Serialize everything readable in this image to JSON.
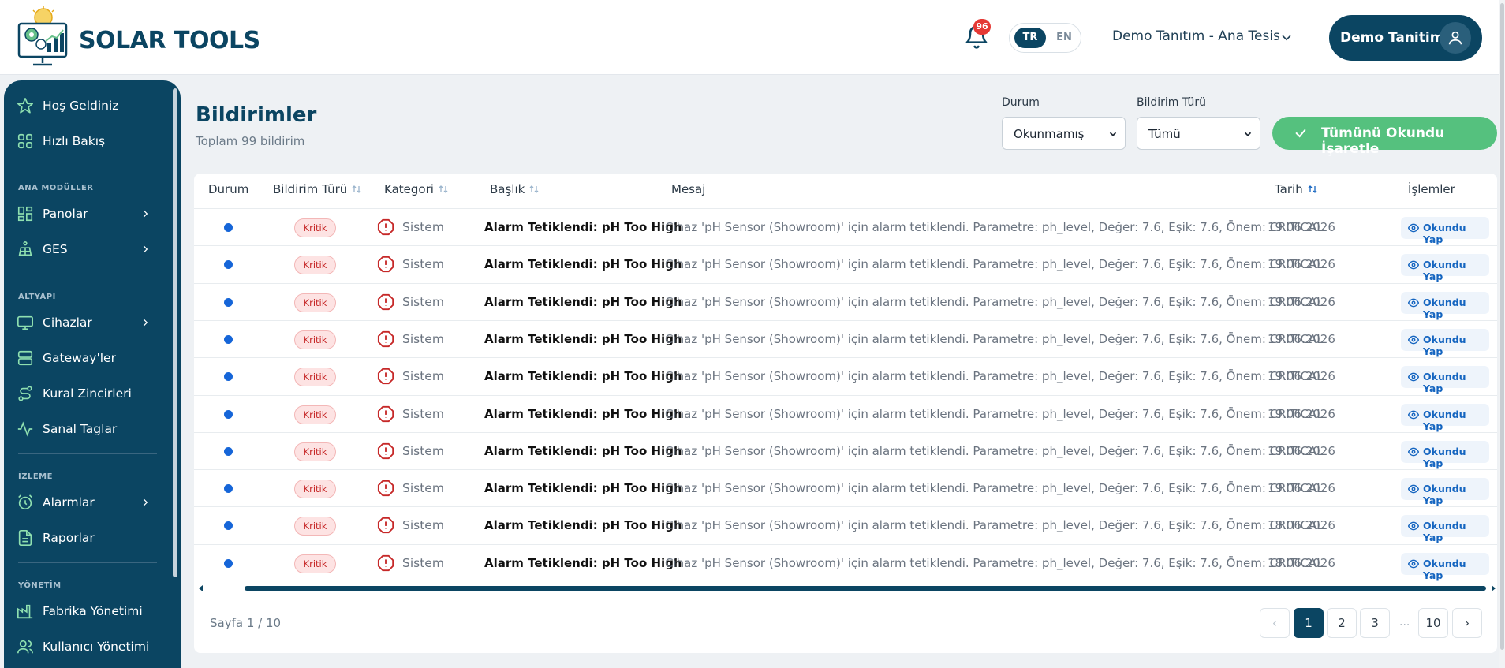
{
  "header": {
    "brand": "SOLAR TOOLS",
    "notification_count": "96",
    "lang_tr": "TR",
    "lang_en": "EN",
    "facility": "Demo Tanıtım - Ana Tesis",
    "user_name": "Demo Tanitim"
  },
  "sidebar": {
    "welcome": "Hoş Geldiniz",
    "overview": "Hızlı Bakış",
    "section_main": "ANA MODÜLLER",
    "dashboards": "Panolar",
    "ges": "GES",
    "section_infra": "ALTYAPI",
    "devices": "Cihazlar",
    "gateways": "Gateway'ler",
    "rule_chains": "Kural Zincirleri",
    "virtual_tags": "Sanal Taglar",
    "section_monitor": "İZLEME",
    "alarms": "Alarmlar",
    "reports": "Raporlar",
    "section_admin": "YÖNETİM",
    "factory_mgmt": "Fabrika Yönetimi",
    "user_mgmt": "Kullanıcı Yönetimi"
  },
  "page": {
    "title": "Bildirimler",
    "subtitle": "Toplam 99 bildirim"
  },
  "filters": {
    "status_label": "Durum",
    "status_value": "Okunmamış",
    "type_label": "Bildirim Türü",
    "type_value": "Tümü",
    "mark_all": "Tümünü Okundu İşaretle"
  },
  "table": {
    "headers": {
      "status": "Durum",
      "type": "Bildirim Türü",
      "category": "Kategori",
      "title": "Başlık",
      "message": "Mesaj",
      "date": "Tarih",
      "actions": "İşlemler"
    },
    "rows": [
      {
        "type": "Kritik",
        "category": "Sistem",
        "title": "Alarm Tetiklendi: pH Too High",
        "message": "Cihaz 'pH Sensor (Showroom)' için alarm tetiklendi. Parametre: ph_level, Değer: 7.6, Eşik: 7.6, Önem: CRITICAL",
        "date": "19.06.2026",
        "action": "Okundu Yap"
      },
      {
        "type": "Kritik",
        "category": "Sistem",
        "title": "Alarm Tetiklendi: pH Too High",
        "message": "Cihaz 'pH Sensor (Showroom)' için alarm tetiklendi. Parametre: ph_level, Değer: 7.6, Eşik: 7.6, Önem: CRITICAL",
        "date": "19.06.2026",
        "action": "Okundu Yap"
      },
      {
        "type": "Kritik",
        "category": "Sistem",
        "title": "Alarm Tetiklendi: pH Too High",
        "message": "Cihaz 'pH Sensor (Showroom)' için alarm tetiklendi. Parametre: ph_level, Değer: 7.6, Eşik: 7.6, Önem: CRITICAL",
        "date": "19.06.2026",
        "action": "Okundu Yap"
      },
      {
        "type": "Kritik",
        "category": "Sistem",
        "title": "Alarm Tetiklendi: pH Too High",
        "message": "Cihaz 'pH Sensor (Showroom)' için alarm tetiklendi. Parametre: ph_level, Değer: 7.6, Eşik: 7.6, Önem: CRITICAL",
        "date": "19.06.2026",
        "action": "Okundu Yap"
      },
      {
        "type": "Kritik",
        "category": "Sistem",
        "title": "Alarm Tetiklendi: pH Too High",
        "message": "Cihaz 'pH Sensor (Showroom)' için alarm tetiklendi. Parametre: ph_level, Değer: 7.6, Eşik: 7.6, Önem: CRITICAL",
        "date": "19.06.2026",
        "action": "Okundu Yap"
      },
      {
        "type": "Kritik",
        "category": "Sistem",
        "title": "Alarm Tetiklendi: pH Too High",
        "message": "Cihaz 'pH Sensor (Showroom)' için alarm tetiklendi. Parametre: ph_level, Değer: 7.6, Eşik: 7.6, Önem: CRITICAL",
        "date": "19.06.2026",
        "action": "Okundu Yap"
      },
      {
        "type": "Kritik",
        "category": "Sistem",
        "title": "Alarm Tetiklendi: pH Too High",
        "message": "Cihaz 'pH Sensor (Showroom)' için alarm tetiklendi. Parametre: ph_level, Değer: 7.6, Eşik: 7.6, Önem: CRITICAL",
        "date": "19.06.2026",
        "action": "Okundu Yap"
      },
      {
        "type": "Kritik",
        "category": "Sistem",
        "title": "Alarm Tetiklendi: pH Too High",
        "message": "Cihaz 'pH Sensor (Showroom)' için alarm tetiklendi. Parametre: ph_level, Değer: 7.6, Eşik: 7.6, Önem: CRITICAL",
        "date": "19.06.2026",
        "action": "Okundu Yap"
      },
      {
        "type": "Kritik",
        "category": "Sistem",
        "title": "Alarm Tetiklendi: pH Too High",
        "message": "Cihaz 'pH Sensor (Showroom)' için alarm tetiklendi. Parametre: ph_level, Değer: 7.6, Eşik: 7.6, Önem: CRITICAL",
        "date": "18.06.2026",
        "action": "Okundu Yap"
      },
      {
        "type": "Kritik",
        "category": "Sistem",
        "title": "Alarm Tetiklendi: pH Too High",
        "message": "Cihaz 'pH Sensor (Showroom)' için alarm tetiklendi. Parametre: ph_level, Değer: 7.6, Eşik: 7.6, Önem: CRITICAL",
        "date": "18.06.2026",
        "action": "Okundu Yap"
      }
    ]
  },
  "pagination": {
    "info": "Sayfa 1 / 10",
    "prev": "‹",
    "pages": [
      "1",
      "2",
      "3"
    ],
    "ellipsis": "...",
    "last": "10",
    "next": "›"
  },
  "colors": {
    "primary": "#0b4562",
    "success": "#55c17e",
    "danger": "#c62828",
    "unread_dot": "#1565d8",
    "link": "#1565c0"
  },
  "icons": {
    "notifications": "bell-icon",
    "user": "user-icon",
    "welcome": "star-icon",
    "overview": "grid-icon",
    "dashboards": "dashboard-icon",
    "ges": "solar-panel-icon",
    "devices": "monitor-icon",
    "gateways": "server-icon",
    "rule_chains": "route-icon",
    "virtual_tags": "activity-icon",
    "alarms": "alarm-clock-icon",
    "reports": "file-text-icon",
    "factory_mgmt": "factory-icon",
    "user_mgmt": "users-icon",
    "category": "alert-octagon-icon",
    "mark_read": "eye-icon",
    "mark_all": "check-icon"
  }
}
